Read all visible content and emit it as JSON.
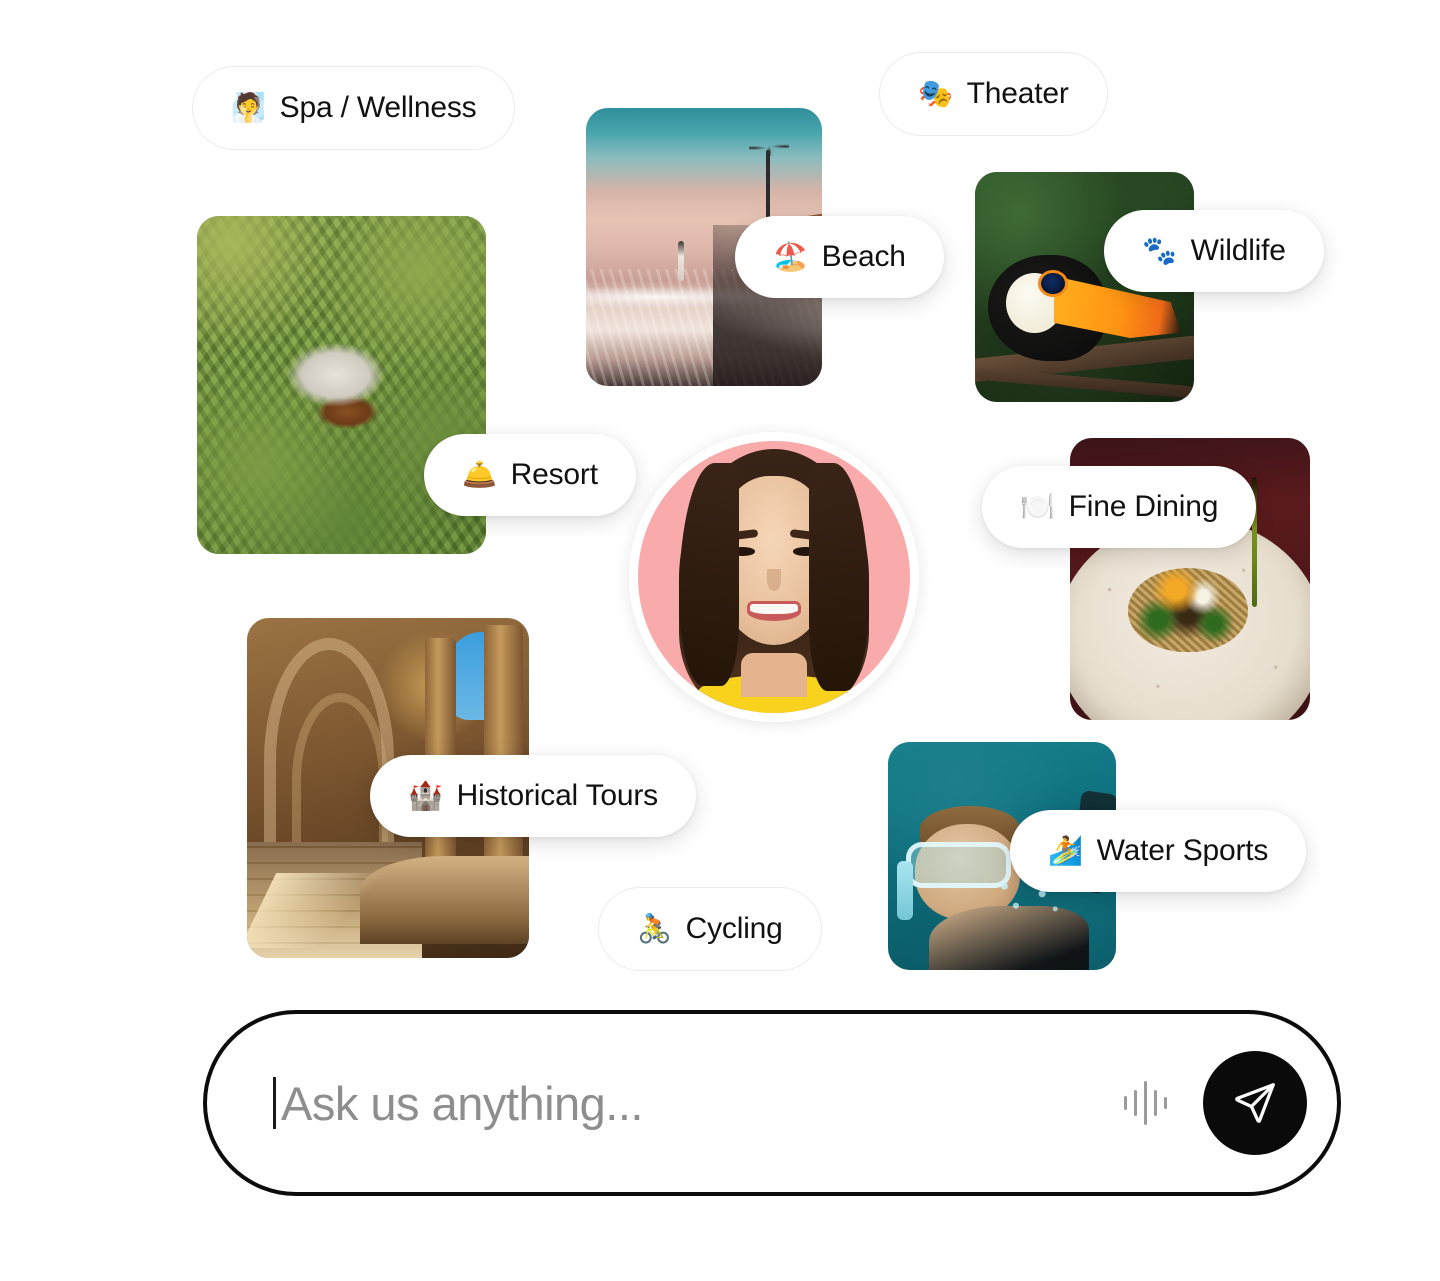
{
  "app": {
    "title": "Travel Assistant Interest Picker"
  },
  "avatar": {
    "name": "assistant-avatar",
    "background_color": "#F9AAAA",
    "ring_color": "#FFFFFF",
    "alt": "Smiling woman in yellow top"
  },
  "images": [
    {
      "id": "resort-image",
      "alt": "Aerial view of thatched-roof villa in tropical palm jungle"
    },
    {
      "id": "beach-image",
      "alt": "Person walking on a sunset beach with palm tree and cliff"
    },
    {
      "id": "wildlife-image",
      "alt": "Toucan perched on a branch in green foliage"
    },
    {
      "id": "fine-dining-image",
      "alt": "Plated gourmet grain dish on a speckled ceramic bowl"
    },
    {
      "id": "historical-tours-image",
      "alt": "Sunlit gothic stone cloister with arches and columns"
    },
    {
      "id": "water-sports-image",
      "alt": "Snorkeler underwater in turquoise sea"
    }
  ],
  "chips": [
    {
      "id": "chip-spa-wellness",
      "emoji": "🧖",
      "emoji_name": "person-in-steamy-room-emoji",
      "label": "Spa / Wellness",
      "style": "flat"
    },
    {
      "id": "chip-theater",
      "emoji": "🎭",
      "emoji_name": "performing-arts-emoji",
      "label": "Theater",
      "style": "flat"
    },
    {
      "id": "chip-beach",
      "emoji": "🏖️",
      "emoji_name": "beach-with-umbrella-emoji",
      "label": "Beach",
      "style": "raised"
    },
    {
      "id": "chip-wildlife",
      "emoji": "🐾",
      "emoji_name": "paw-prints-emoji",
      "label": "Wildlife",
      "style": "raised"
    },
    {
      "id": "chip-resort",
      "emoji": "🛎️",
      "emoji_name": "bellhop-bell-emoji",
      "label": "Resort",
      "style": "raised"
    },
    {
      "id": "chip-fine-dining",
      "emoji": "🍽️",
      "emoji_name": "fork-and-knife-with-plate-emoji",
      "label": "Fine Dining",
      "style": "raised"
    },
    {
      "id": "chip-historical-tours",
      "emoji": "🏰",
      "emoji_name": "castle-emoji",
      "label": "Historical Tours",
      "style": "raised"
    },
    {
      "id": "chip-water-sports",
      "emoji": "🏄",
      "emoji_name": "surfer-emoji",
      "label": "Water Sports",
      "style": "raised"
    },
    {
      "id": "chip-cycling",
      "emoji": "🚴",
      "emoji_name": "cyclist-emoji",
      "label": "Cycling",
      "style": "flat"
    }
  ],
  "composer": {
    "placeholder": "Ask us anything...",
    "value": "",
    "caret_visible": true,
    "voice_icon": "waveform-icon",
    "send_icon": "paper-plane-icon",
    "border_color": "#0C0C0C",
    "send_button_color": "#0A0A0A",
    "placeholder_color": "#8E8E8E"
  }
}
